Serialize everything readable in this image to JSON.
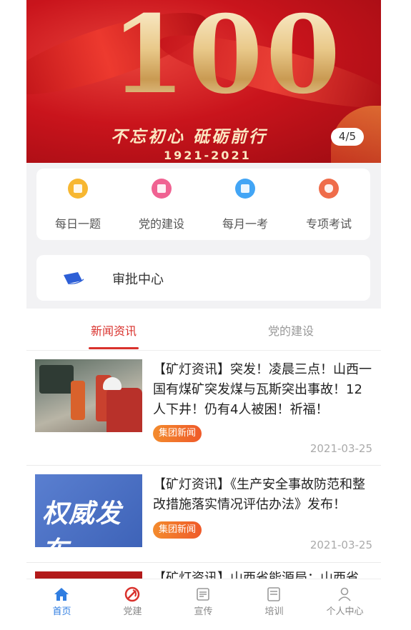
{
  "banner": {
    "headline_number": "100",
    "slogan": "不忘初心 砥砺前行",
    "years": "1921-2021",
    "counter": "4/5"
  },
  "quick_menu": [
    {
      "label": "每日一题",
      "icon": "daily-question-icon",
      "color": "#f7b731"
    },
    {
      "label": "党的建设",
      "icon": "party-building-icon",
      "color": "#f06292"
    },
    {
      "label": "每月一考",
      "icon": "monthly-exam-icon",
      "color": "#42a5f5"
    },
    {
      "label": "专项考试",
      "icon": "special-exam-icon",
      "color": "#ef6c4a"
    }
  ],
  "approval": {
    "label": "审批中心",
    "icon": "approval-book-icon"
  },
  "tabs": [
    {
      "label": "新闻资讯",
      "active": true
    },
    {
      "label": "党的建设",
      "active": false
    }
  ],
  "news": [
    {
      "title": "【矿灯资讯】突发！凌晨三点！山西一国有煤矿突发煤与瓦斯突出事故！12人下井！仍有4人被困！祈福！",
      "tag": "集团新闻",
      "date": "2021-03-25"
    },
    {
      "title": "【矿灯资讯】《生产安全事故防范和整改措施落实情况评估办法》发布！",
      "tag": "集团新闻",
      "date": "2021-03-25",
      "thumb_text": "权威发布"
    },
    {
      "title": "【矿灯资讯】山西省能源局：山西省"
    }
  ],
  "bottom_nav": [
    {
      "label": "首页",
      "icon": "home-icon",
      "active": true
    },
    {
      "label": "党建",
      "icon": "party-emblem-icon",
      "active": false
    },
    {
      "label": "宣传",
      "icon": "publicity-icon",
      "active": false
    },
    {
      "label": "培训",
      "icon": "training-icon",
      "active": false
    },
    {
      "label": "个人中心",
      "icon": "user-icon",
      "active": false
    }
  ],
  "colors": {
    "accent_red": "#d9312c",
    "nav_active_blue": "#2f7de1",
    "tag_orange": "#f06a2b"
  }
}
